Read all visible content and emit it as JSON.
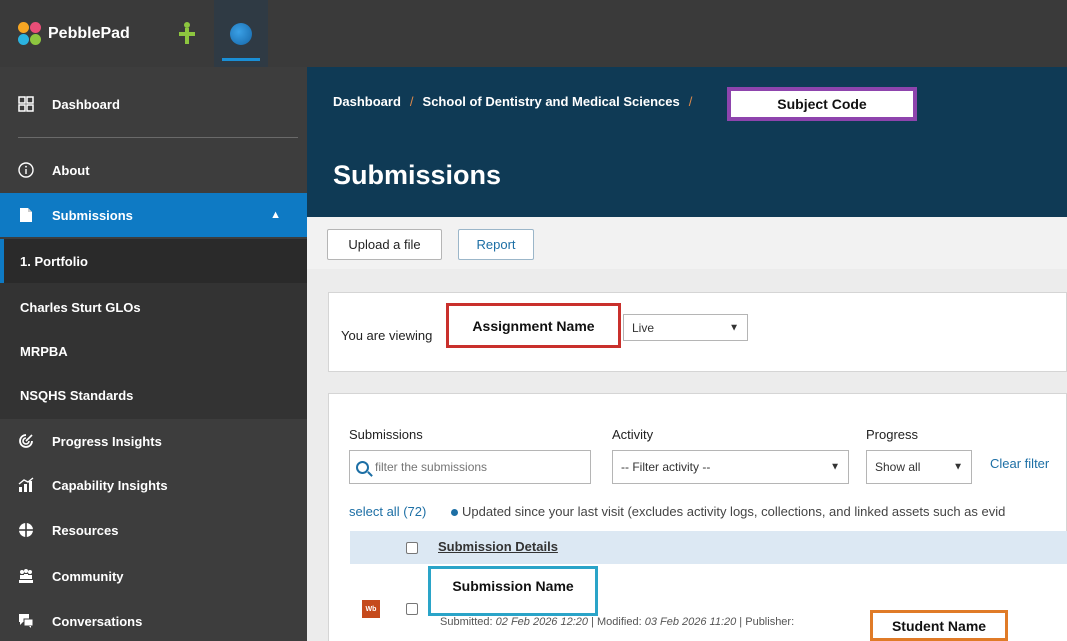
{
  "app": {
    "name": "PebblePad"
  },
  "sidebar": {
    "items": [
      {
        "label": "Dashboard",
        "icon": "dashboard-icon"
      },
      {
        "label": "About",
        "icon": "info-icon"
      },
      {
        "label": "Submissions",
        "icon": "document-icon"
      },
      {
        "label": "1. Portfolio"
      },
      {
        "label": "Charles Sturt GLOs"
      },
      {
        "label": "MRPBA"
      },
      {
        "label": "NSQHS Standards"
      },
      {
        "label": "Progress Insights",
        "icon": "progress-icon"
      },
      {
        "label": "Capability Insights",
        "icon": "capability-icon"
      },
      {
        "label": "Resources",
        "icon": "resources-icon"
      },
      {
        "label": "Community",
        "icon": "community-icon"
      },
      {
        "label": "Conversations",
        "icon": "conversations-icon"
      }
    ]
  },
  "header": {
    "breadcrumb": [
      "Dashboard",
      "School of Dentistry and Medical Sciences"
    ],
    "breadcrumb_sep": "/",
    "subject_code": "Subject Code",
    "title": "Submissions"
  },
  "toolbar": {
    "upload_label": "Upload a file",
    "report_label": "Report"
  },
  "viewing": {
    "label": "You are viewing",
    "assignment_name": "Assignment Name",
    "status_value": "Live"
  },
  "filters": {
    "submissions_label": "Submissions",
    "search_placeholder": "filter the submissions",
    "activity_label": "Activity",
    "activity_value": "-- Filter activity --",
    "progress_label": "Progress",
    "progress_value": "Show all",
    "clear_label": "Clear filter"
  },
  "list": {
    "select_all": "select all (72)",
    "updated_note": "Updated since your last visit (excludes activity logs, collections, and linked assets such as evid",
    "column_header": "Submission Details",
    "rows": [
      {
        "icon_label": "Wb",
        "name": "Submission Name",
        "submitted_label": "Submitted:",
        "submitted": "02 Feb 2026 12:20",
        "modified_label": "Modified:",
        "modified": "03 Feb 2026 11:20",
        "publisher_label": "Publisher:",
        "student": "Student Name"
      }
    ]
  },
  "colors": {
    "topbar": "#3a3a3a",
    "sidebar": "#3d3d3d",
    "accent": "#0e7ac4",
    "header": "#0f3a55",
    "subject_border": "#8e44ad",
    "assignment_border": "#c9302c",
    "submission_border": "#2aa4c8",
    "student_border": "#e07b27"
  }
}
